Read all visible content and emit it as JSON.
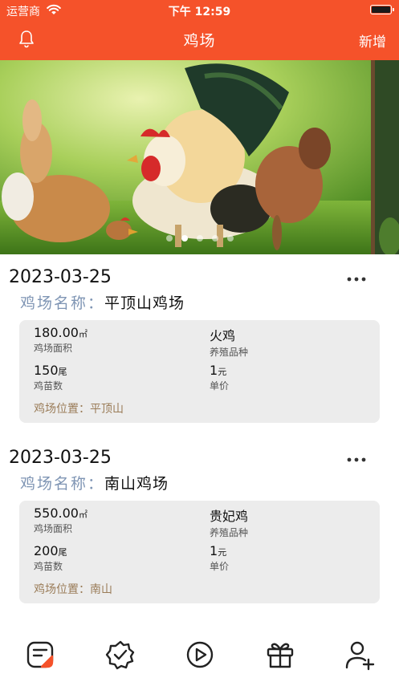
{
  "status_bar": {
    "carrier": "运营商",
    "time": "下午 12:59"
  },
  "header": {
    "title": "鸡场",
    "add_label": "新增"
  },
  "banner": {
    "slide_count": 5,
    "active_slide": 2
  },
  "farms": [
    {
      "date": "2023-03-25",
      "name_label": "鸡场名称：",
      "name": "平顶山鸡场",
      "area_value": "180.00",
      "area_unit": "㎡",
      "area_label": "鸡场面积",
      "breed_value": "火鸡",
      "breed_label": "养殖品种",
      "chicks_value": "150",
      "chicks_unit": "尾",
      "chicks_label": "鸡苗数",
      "price_value": "1",
      "price_unit": "元",
      "price_label": "单价",
      "location_label": "鸡场位置：",
      "location": "平顶山"
    },
    {
      "date": "2023-03-25",
      "name_label": "鸡场名称：",
      "name": "南山鸡场",
      "area_value": "550.00",
      "area_unit": "㎡",
      "area_label": "鸡场面积",
      "breed_value": "贵妃鸡",
      "breed_label": "养殖品种",
      "chicks_value": "200",
      "chicks_unit": "尾",
      "chicks_label": "鸡苗数",
      "price_value": "1",
      "price_unit": "元",
      "price_label": "单价",
      "location_label": "鸡场位置：",
      "location": "南山"
    }
  ],
  "tabbar": {
    "items": [
      {
        "icon": "note-icon",
        "active": true
      },
      {
        "icon": "badge-check-icon",
        "active": false
      },
      {
        "icon": "play-circle-icon",
        "active": false
      },
      {
        "icon": "gift-icon",
        "active": false
      },
      {
        "icon": "add-user-icon",
        "active": false
      }
    ]
  },
  "colors": {
    "accent": "#f5522a",
    "label_blue": "#7f95b4",
    "location_brown": "#9a7c58",
    "box_bg": "#ececec"
  }
}
